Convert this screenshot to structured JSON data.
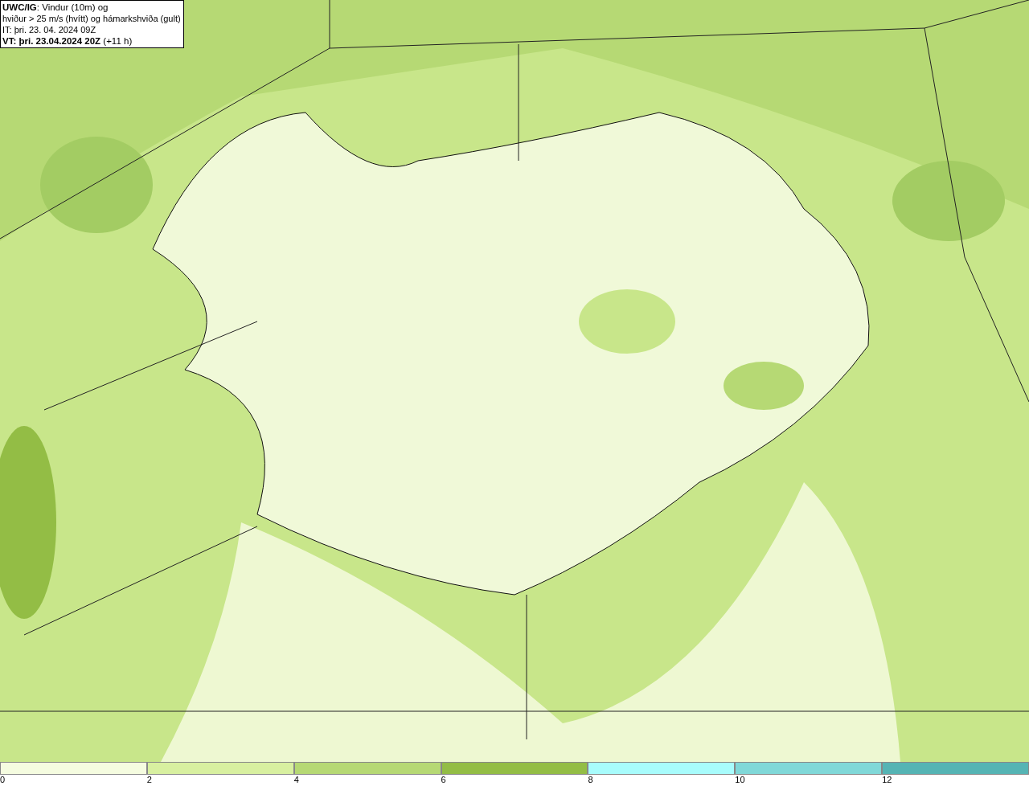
{
  "info_box": {
    "lines": [
      "**UWC/IG**: Vindur (10m) og",
      "hviður > 25 m/s (hvítt) og hámarkshviða (gult)",
      "IT: þri. 23. 04. 2024 09Z",
      "**VT: þri. 23.04.2024 20Z** (+11 h)"
    ]
  },
  "legend": [
    {
      "label": "0",
      "color": "#f5fce0"
    },
    {
      "label": "2",
      "color": "#d8f0a0"
    },
    {
      "label": "4",
      "color": "#b6d974"
    },
    {
      "label": "6",
      "color": "#93bd45"
    },
    {
      "label": "8",
      "color": "#a8fcfc"
    },
    {
      "label": "10",
      "color": "#80d8d8"
    },
    {
      "label": "12",
      "color": "#55b4b4"
    }
  ]
}
